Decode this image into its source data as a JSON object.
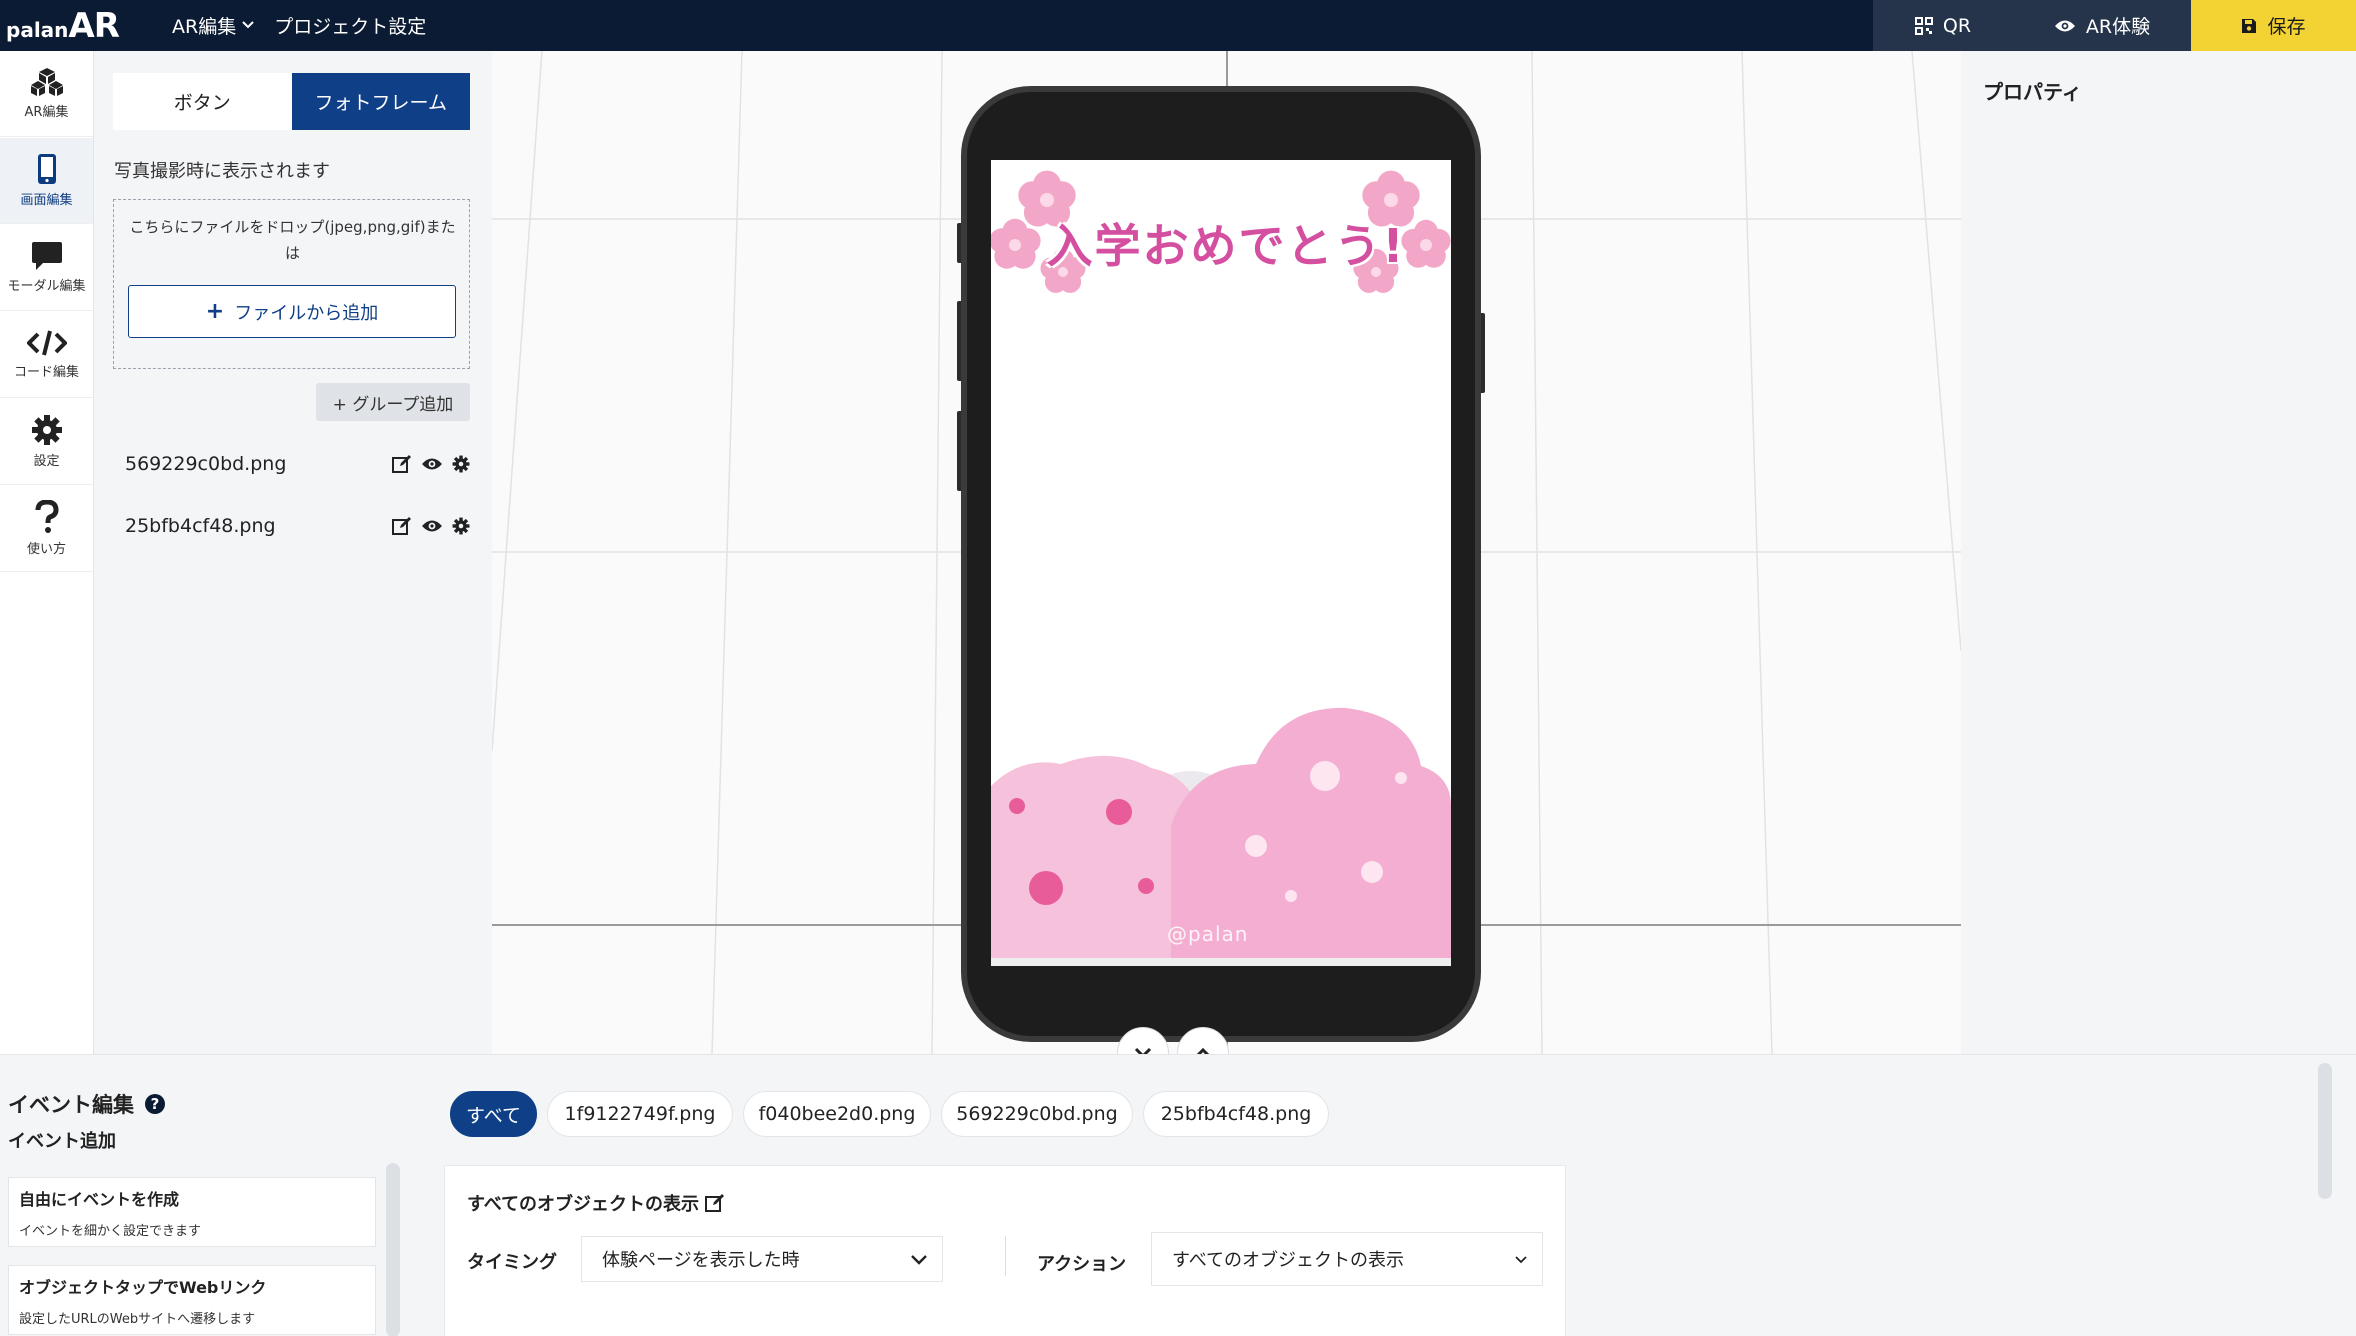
{
  "app": {
    "logo_small": "palan",
    "logo_big": "AR"
  },
  "topmenu": {
    "ar_edit": "AR編集",
    "project_settings": "プロジェクト設定"
  },
  "topright": {
    "qr": "QR",
    "ar_experience": "AR体験",
    "save": "保存",
    "save_color": "#f3d233"
  },
  "leftnav": {
    "items": [
      {
        "label": "AR編集",
        "icon": "cubes-icon"
      },
      {
        "label": "画面編集",
        "icon": "smartphone-icon"
      },
      {
        "label": "モーダル編集",
        "icon": "chat-bubble-icon"
      },
      {
        "label": "コード編集",
        "icon": "code-icon"
      },
      {
        "label": "設定",
        "icon": "gear-icon"
      },
      {
        "label": "使い方",
        "icon": "question-icon"
      }
    ]
  },
  "leftpanel": {
    "tab_button": "ボタン",
    "tab_photoframe": "フォトフレーム",
    "hint": "写真撮影時に表示されます",
    "drop_text": "こちらにファイルをドロップ(jpeg,png,gif)または",
    "add_file": "ファイルから追加",
    "group_add": "+ グループ追加",
    "files": [
      "569229c0bd.png",
      "25bfb4cf48.png"
    ]
  },
  "frame": {
    "greeting": "入学おめでとう!",
    "watermark": "@palan"
  },
  "props": {
    "title": "プロパティ"
  },
  "events": {
    "title": "イベント編集",
    "add_title": "イベント追加",
    "cards": [
      {
        "title": "自由にイベントを作成",
        "sub": "イベントを細かく設定できます"
      },
      {
        "title": "オブジェクトタップでWebリンク",
        "sub": "設定したURLのWebサイトへ遷移します"
      }
    ],
    "filters": [
      "すべて",
      "1f9122749f.png",
      "f040bee2d0.png",
      "569229c0bd.png",
      "25bfb4cf48.png"
    ],
    "panel_title": "すべてのオブジェクトの表示",
    "timing_label": "タイミング",
    "timing_value": "体験ページを表示した時",
    "action_label": "アクション",
    "action_value": "すべてのオブジェクトの表示"
  }
}
